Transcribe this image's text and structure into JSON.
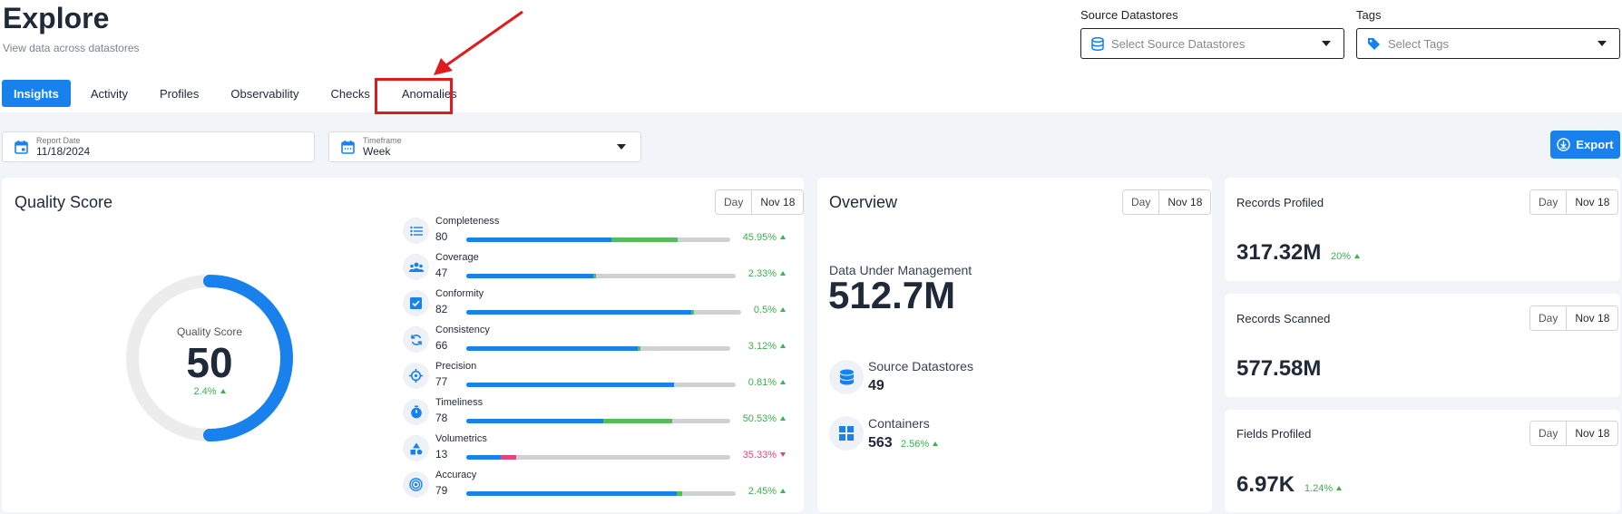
{
  "header": {
    "title": "Explore",
    "subtitle": "View data across datastores"
  },
  "filters": {
    "source_label": "Source Datastores",
    "source_placeholder": "Select Source Datastores",
    "tags_label": "Tags",
    "tags_placeholder": "Select Tags"
  },
  "tabs": [
    {
      "label": "Insights",
      "active": true
    },
    {
      "label": "Activity"
    },
    {
      "label": "Profiles"
    },
    {
      "label": "Observability"
    },
    {
      "label": "Checks"
    },
    {
      "label": "Anomalies",
      "highlighted": true
    }
  ],
  "controls": {
    "report_date_label": "Report Date",
    "report_date_value": "11/18/2024",
    "timeframe_label": "Timeframe",
    "timeframe_value": "Week",
    "export_label": "Export"
  },
  "quality": {
    "title": "Quality Score",
    "pill_day": "Day",
    "pill_date": "Nov 18",
    "gauge_label": "Quality Score",
    "score": "50",
    "score_value": 50,
    "change": "2.4%",
    "metrics": [
      {
        "name": "Completeness",
        "value": "80",
        "change": "45.95%",
        "dir": "up",
        "primary": 0.55,
        "secondary": 0.25,
        "icon": "list-icon"
      },
      {
        "name": "Coverage",
        "value": "47",
        "change": "2.33%",
        "dir": "up",
        "primary": 0.47,
        "secondary": 0.01,
        "icon": "people-icon"
      },
      {
        "name": "Conformity",
        "value": "82",
        "change": "0.5%",
        "dir": "up",
        "primary": 0.82,
        "secondary": 0.01,
        "icon": "checkbox-icon"
      },
      {
        "name": "Consistency",
        "value": "66",
        "change": "3.12%",
        "dir": "up",
        "primary": 0.65,
        "secondary": 0.01,
        "icon": "sync-icon"
      },
      {
        "name": "Precision",
        "value": "77",
        "change": "0.81%",
        "dir": "up",
        "primary": 0.77,
        "secondary": 0.0,
        "icon": "crosshair-icon"
      },
      {
        "name": "Timeliness",
        "value": "78",
        "change": "50.53%",
        "dir": "up",
        "primary": 0.52,
        "secondary": 0.26,
        "icon": "timer-icon"
      },
      {
        "name": "Volumetrics",
        "value": "13",
        "change": "35.33%",
        "dir": "down",
        "primary": 0.13,
        "secondary": 0.06,
        "icon": "shapes-icon"
      },
      {
        "name": "Accuracy",
        "value": "79",
        "change": "2.45%",
        "dir": "up",
        "primary": 0.78,
        "secondary": 0.02,
        "icon": "target-icon"
      }
    ]
  },
  "overview": {
    "title": "Overview",
    "pill_day": "Day",
    "pill_date": "Nov 18",
    "dum_label": "Data Under Management",
    "dum_value": "512.7M",
    "source_label": "Source Datastores",
    "source_value": "49",
    "containers_label": "Containers",
    "containers_value": "563",
    "containers_change": "2.56%"
  },
  "stats": [
    {
      "title": "Records Profiled",
      "value": "317.32M",
      "change": "20%",
      "day": "Day",
      "date": "Nov 18"
    },
    {
      "title": "Records Scanned",
      "value": "577.58M",
      "change": "",
      "day": "Day",
      "date": "Nov 18"
    },
    {
      "title": "Fields Profiled",
      "value": "6.97K",
      "change": "1.24%",
      "day": "Day",
      "date": "Nov 18"
    }
  ],
  "colors": {
    "accent": "#1881ec",
    "green": "#5cb85c",
    "track": "#cfd1d4",
    "highlight": "#e01b1b",
    "down": "#e0457b"
  }
}
